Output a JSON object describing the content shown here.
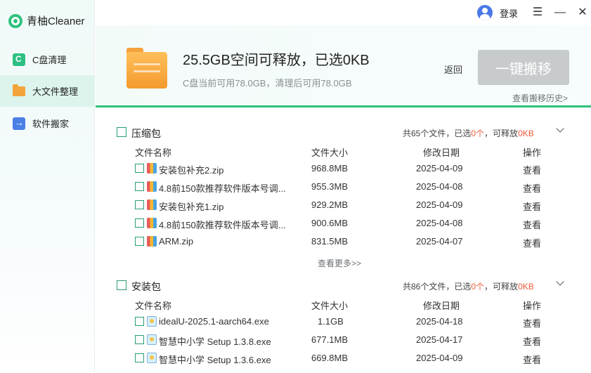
{
  "app": {
    "title": "青柚Cleaner"
  },
  "sidebar": {
    "items": [
      {
        "label": "C盘清理",
        "icon": "c-drive-icon"
      },
      {
        "label": "大文件整理",
        "icon": "folder-icon",
        "active": true
      },
      {
        "label": "软件搬家",
        "icon": "move-icon"
      }
    ]
  },
  "topbar": {
    "login": "登录",
    "menu_icon": "☰",
    "min_icon": "—",
    "close_icon": "✕"
  },
  "hero": {
    "title": "25.5GB空间可释放，已选0KB",
    "subtitle": "C盘当前可用78.0GB，清理后可用78.0GB",
    "back": "返回",
    "action": "一键搬移",
    "history": "查看搬移历史>"
  },
  "columns": {
    "name": "文件名称",
    "size": "文件大小",
    "date": "修改日期",
    "op": "操作"
  },
  "groups": [
    {
      "name": "压缩包",
      "summary_pre": "共65个文件，已选",
      "selected": "0个",
      "summary_mid": "，可释放",
      "free": "0KB",
      "more": "查看更多>>",
      "files": [
        {
          "name": "安装包补充2.zip",
          "size": "968.8MB",
          "date": "2025-04-09",
          "op": "查看",
          "type": "zip"
        },
        {
          "name": "4.8前150款推荐软件版本号调...",
          "size": "955.3MB",
          "date": "2025-04-08",
          "op": "查看",
          "type": "zip"
        },
        {
          "name": "安装包补充1.zip",
          "size": "929.2MB",
          "date": "2025-04-09",
          "op": "查看",
          "type": "zip"
        },
        {
          "name": "4.8前150款推荐软件版本号调...",
          "size": "900.6MB",
          "date": "2025-04-08",
          "op": "查看",
          "type": "zip"
        },
        {
          "name": "ARM.zip",
          "size": "831.5MB",
          "date": "2025-04-07",
          "op": "查看",
          "type": "zip"
        }
      ]
    },
    {
      "name": "安装包",
      "summary_pre": "共86个文件，已选",
      "selected": "0个",
      "summary_mid": "，可释放",
      "free": "0KB",
      "files": [
        {
          "name": "idealU-2025.1-aarch64.exe",
          "size": "1.1GB",
          "date": "2025-04-18",
          "op": "查看",
          "type": "exe"
        },
        {
          "name": "智慧中小学 Setup 1.3.8.exe",
          "size": "677.1MB",
          "date": "2025-04-17",
          "op": "查看",
          "type": "exe"
        },
        {
          "name": "智慧中小学 Setup 1.3.6.exe",
          "size": "669.8MB",
          "date": "2025-04-09",
          "op": "查看",
          "type": "exe"
        }
      ]
    }
  ]
}
